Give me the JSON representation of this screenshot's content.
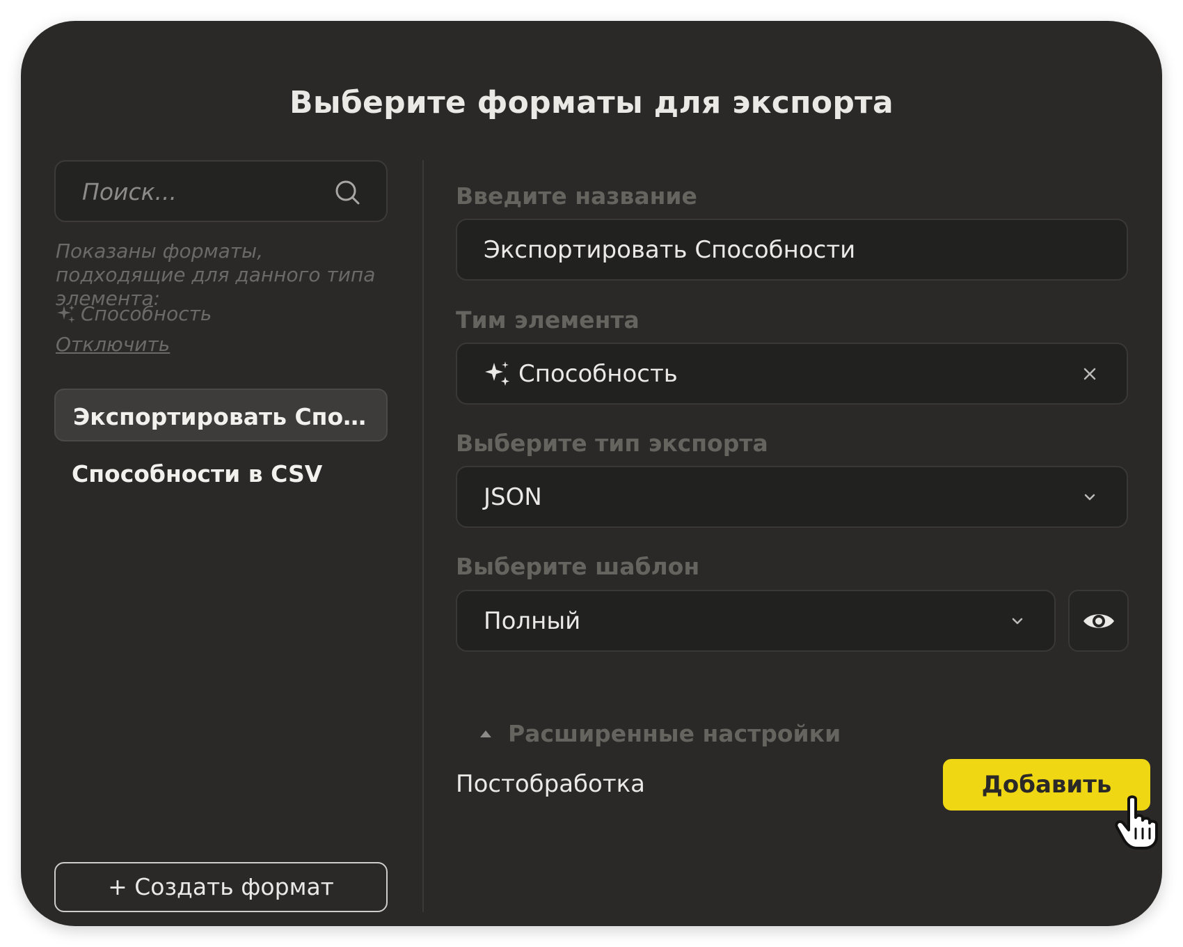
{
  "dialog": {
    "title": "Выберите форматы для экспорта"
  },
  "sidebar": {
    "search_placeholder": "Поиск...",
    "hint": "Показаны форматы, подходящие для данного типа элемента:",
    "hint_type": "Способность",
    "disable_link": "Отключить",
    "formats": [
      {
        "label": "Экспортировать Способности",
        "selected": true
      },
      {
        "label": "Способности в CSV",
        "selected": false
      }
    ],
    "create_button": "+ Создать формат"
  },
  "form": {
    "name_label": "Введите название",
    "name_value": "Экспортировать Способности",
    "element_type_label": "Тим элемента",
    "element_type_value": "Способность",
    "export_type_label": "Выберите тип экспорта",
    "export_type_value": "JSON",
    "template_label": "Выберите шаблон",
    "template_value": "Полный",
    "advanced_label": "Расширенные настройки",
    "postprocess_label": "Постобработка",
    "add_button": "Добавить"
  },
  "colors": {
    "accent": "#f0d714",
    "background": "#2a2928"
  },
  "icons": {
    "search": "search-icon",
    "sparkle": "sparkle-icon",
    "clear": "close-icon",
    "dropdown": "chevron-down-icon",
    "preview": "eye-icon",
    "collapse": "triangle-up-icon",
    "cursor": "hand-pointer-icon"
  }
}
